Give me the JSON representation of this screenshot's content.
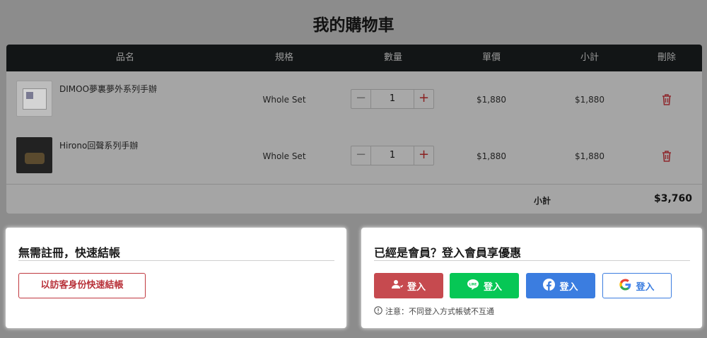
{
  "page": {
    "title": "我的購物車"
  },
  "cart": {
    "headers": {
      "name": "品名",
      "spec": "規格",
      "qty": "數量",
      "price": "單價",
      "subtotal": "小計",
      "delete": "刪除"
    },
    "items": [
      {
        "name": "DIMOO夢裏夢外系列手辦",
        "spec": "Whole Set",
        "qty": "1",
        "price": "$1,880",
        "subtotal": "$1,880"
      },
      {
        "name": "Hirono回聲系列手辦",
        "spec": "Whole Set",
        "qty": "1",
        "price": "$1,880",
        "subtotal": "$1,880"
      }
    ],
    "qty_minus": "−",
    "qty_plus": "+",
    "subtotal_label": "小計",
    "total": "$3,760"
  },
  "guest": {
    "title": "無需註冊，快速結帳",
    "button": "以訪客身份快速結帳"
  },
  "member": {
    "title": "已經是會員？登入會員享優惠",
    "buttons": {
      "member": "登入",
      "line": "登入",
      "facebook": "登入",
      "google": "登入"
    },
    "line_icon_text": "LINE",
    "note": "注意：不同登入方式帳號不互通"
  },
  "colors": {
    "member_red": "#c64a4f",
    "line_green": "#06c755",
    "facebook_blue": "#3b7de0",
    "guest_red": "#c0383f"
  },
  "icons": [
    "user-icon",
    "line-icon",
    "facebook-icon",
    "google-icon",
    "trash-icon",
    "info-icon"
  ]
}
